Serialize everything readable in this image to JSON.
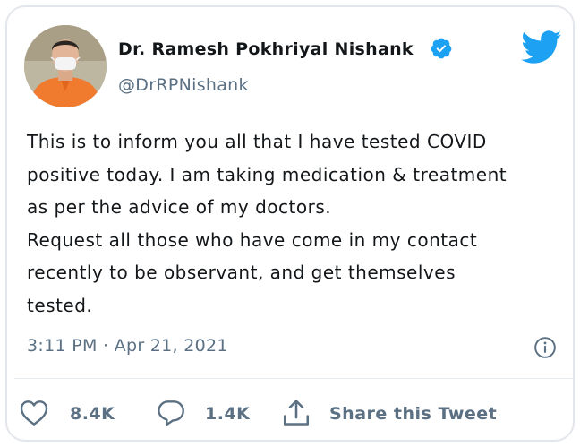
{
  "author": {
    "name": "Dr. Ramesh Pokhriyal Nishank",
    "handle": "@DrRPNishank",
    "verified": true
  },
  "tweet": {
    "lines": [
      "This is to inform you all that I have tested COVID",
      "positive today. I am taking medication & treatment",
      "as per the advice of my doctors.",
      "Request all those who have come in my contact",
      "recently to be observant, and get themselves",
      "tested."
    ],
    "timestamp": "3:11 PM · Apr 21, 2021"
  },
  "actions": {
    "likes": "8.4K",
    "replies": "1.4K",
    "share_label": "Share this Tweet"
  },
  "icons": {
    "brand": "twitter-bird-icon",
    "verified": "verified-badge-icon",
    "info": "info-icon",
    "like": "heart-icon",
    "reply": "reply-icon",
    "share": "share-icon"
  },
  "colors": {
    "twitter_blue": "#1da1f2",
    "secondary_text": "#5b7083",
    "primary_text": "#14171a"
  }
}
